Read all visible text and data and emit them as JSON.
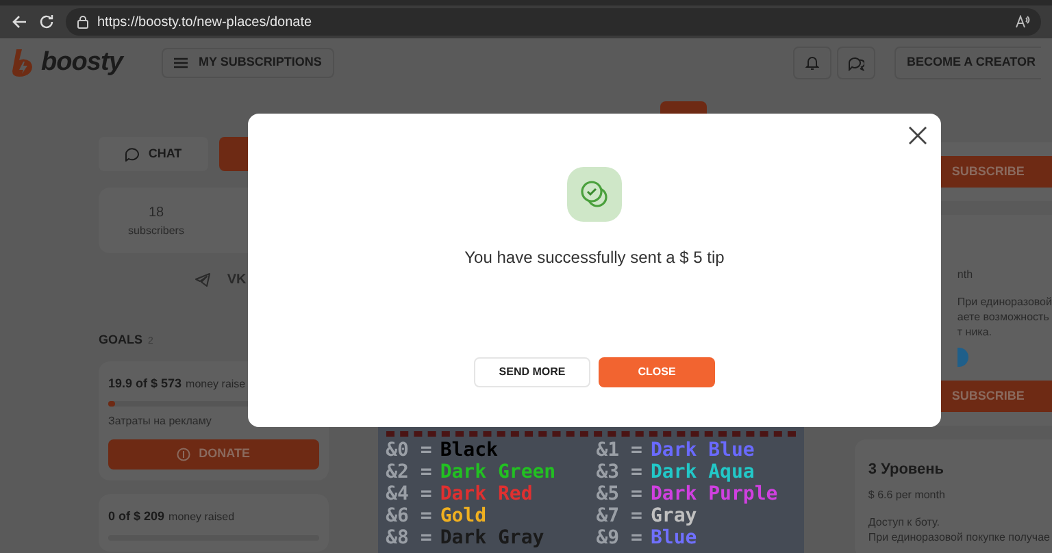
{
  "browser": {
    "url": "https://boosty.to/new-places/donate"
  },
  "header": {
    "logo": "boosty",
    "menu_button": "MY SUBSCRIPTIONS",
    "creator_button": "BECOME A CREATOR"
  },
  "profile": {
    "chat_button": "CHAT",
    "stats": [
      {
        "value": "18",
        "label": "subscribers"
      }
    ],
    "social_text": "VK"
  },
  "goals": {
    "title": "GOALS",
    "count": "2",
    "items": [
      {
        "raised": "19.9 of $ 573",
        "caption": "money raise",
        "level": 0.035,
        "description": "Затраты на рекламу",
        "button": "DONATE"
      },
      {
        "raised": "0 of $ 209",
        "caption": "money raised"
      }
    ]
  },
  "color_codes": [
    {
      "code": "&0 =",
      "name": "Black",
      "color": "#000000"
    },
    {
      "code": "&1 =",
      "name": "Dark Blue",
      "color": "#6a6aff"
    },
    {
      "code": "&2 =",
      "name": "Dark Green",
      "color": "#22c022"
    },
    {
      "code": "&3 =",
      "name": "Dark Aqua",
      "color": "#22c8c8"
    },
    {
      "code": "&4 =",
      "name": "Dark Red",
      "color": "#e03030"
    },
    {
      "code": "&5 =",
      "name": "Dark Purple",
      "color": "#d040e0"
    },
    {
      "code": "&6 =",
      "name": "Gold",
      "color": "#f0b020"
    },
    {
      "code": "&7 =",
      "name": "Gray",
      "color": "#c0c0c0"
    },
    {
      "code": "&8 =",
      "name": "Dark Gray",
      "color": "#1a1a1a"
    },
    {
      "code": "&9 =",
      "name": "Blue",
      "color": "#7070ff"
    }
  ],
  "tiers": [
    {
      "button": "SUBSCRIBE"
    },
    {
      "price": "nth",
      "description": [
        "При единоразовой",
        "аете возможность",
        "т ника."
      ],
      "button": "SUBSCRIBE"
    },
    {
      "title": "3 Уровень",
      "price": "$ 6.6 per month",
      "description": [
        "Доступ к боту.",
        "При единоразовой покупке получае"
      ]
    }
  ],
  "modal": {
    "message": "You have successfully sent a $ 5 tip",
    "buttons": [
      {
        "label": "SEND MORE",
        "kind": "secondary"
      },
      {
        "label": "CLOSE",
        "kind": "primary"
      }
    ]
  }
}
